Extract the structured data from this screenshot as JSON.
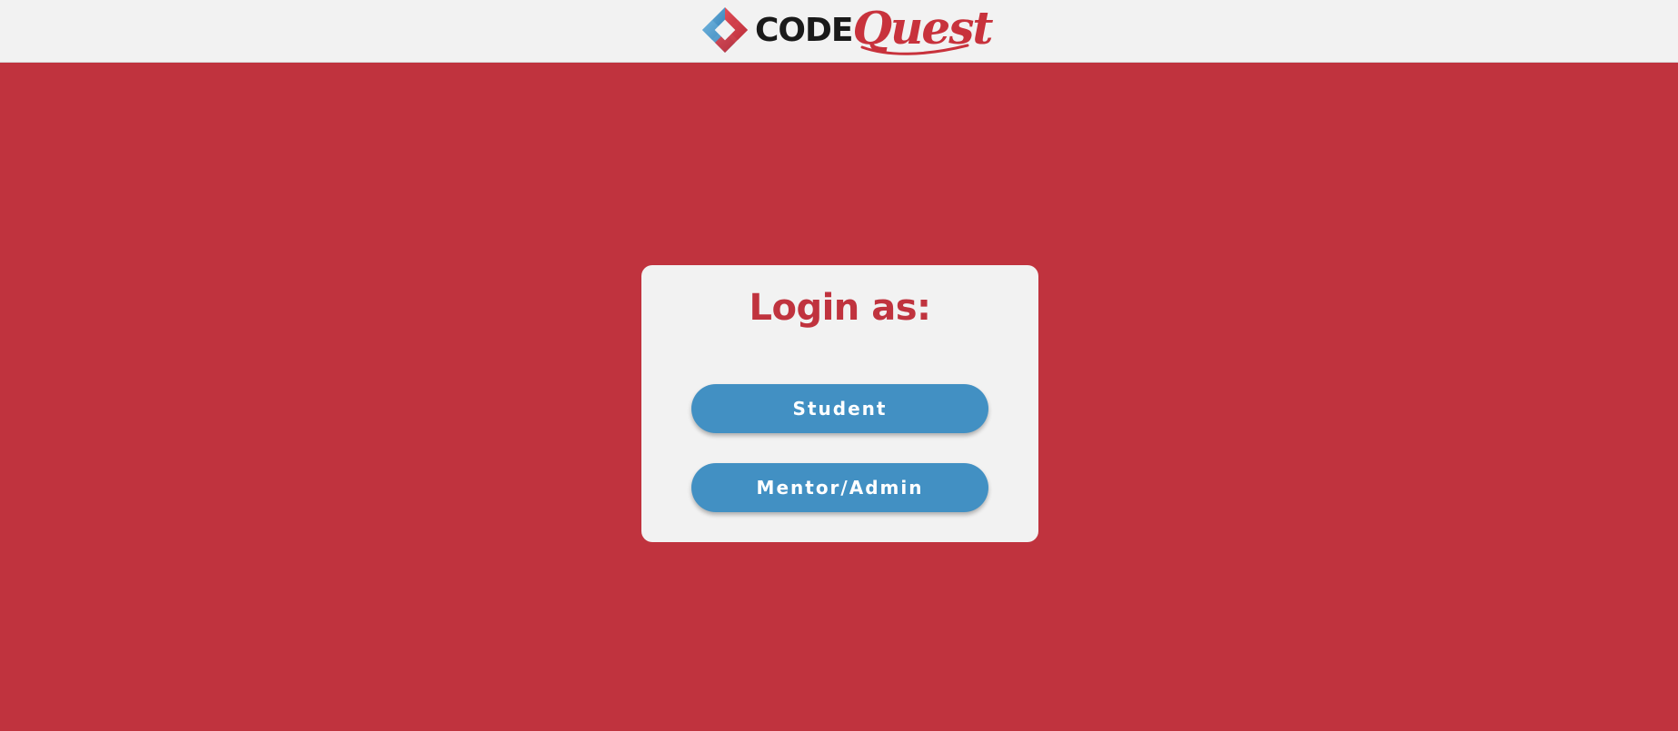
{
  "header": {
    "logo_code": "CODE",
    "logo_quest": "Quest",
    "logo_icon": "codequest-diamond-icon"
  },
  "login": {
    "title": "Login as:",
    "options": [
      {
        "label": "Student"
      },
      {
        "label": "Mentor/Admin"
      }
    ]
  },
  "colors": {
    "background": "#c0333e",
    "header_background": "#f2f2f2",
    "card_background": "#f2f2f2",
    "title": "#c0333e",
    "button": "#4290c3",
    "button_text": "#ffffff",
    "logo_red": "#c8323c",
    "logo_blue": "#4290c3"
  }
}
